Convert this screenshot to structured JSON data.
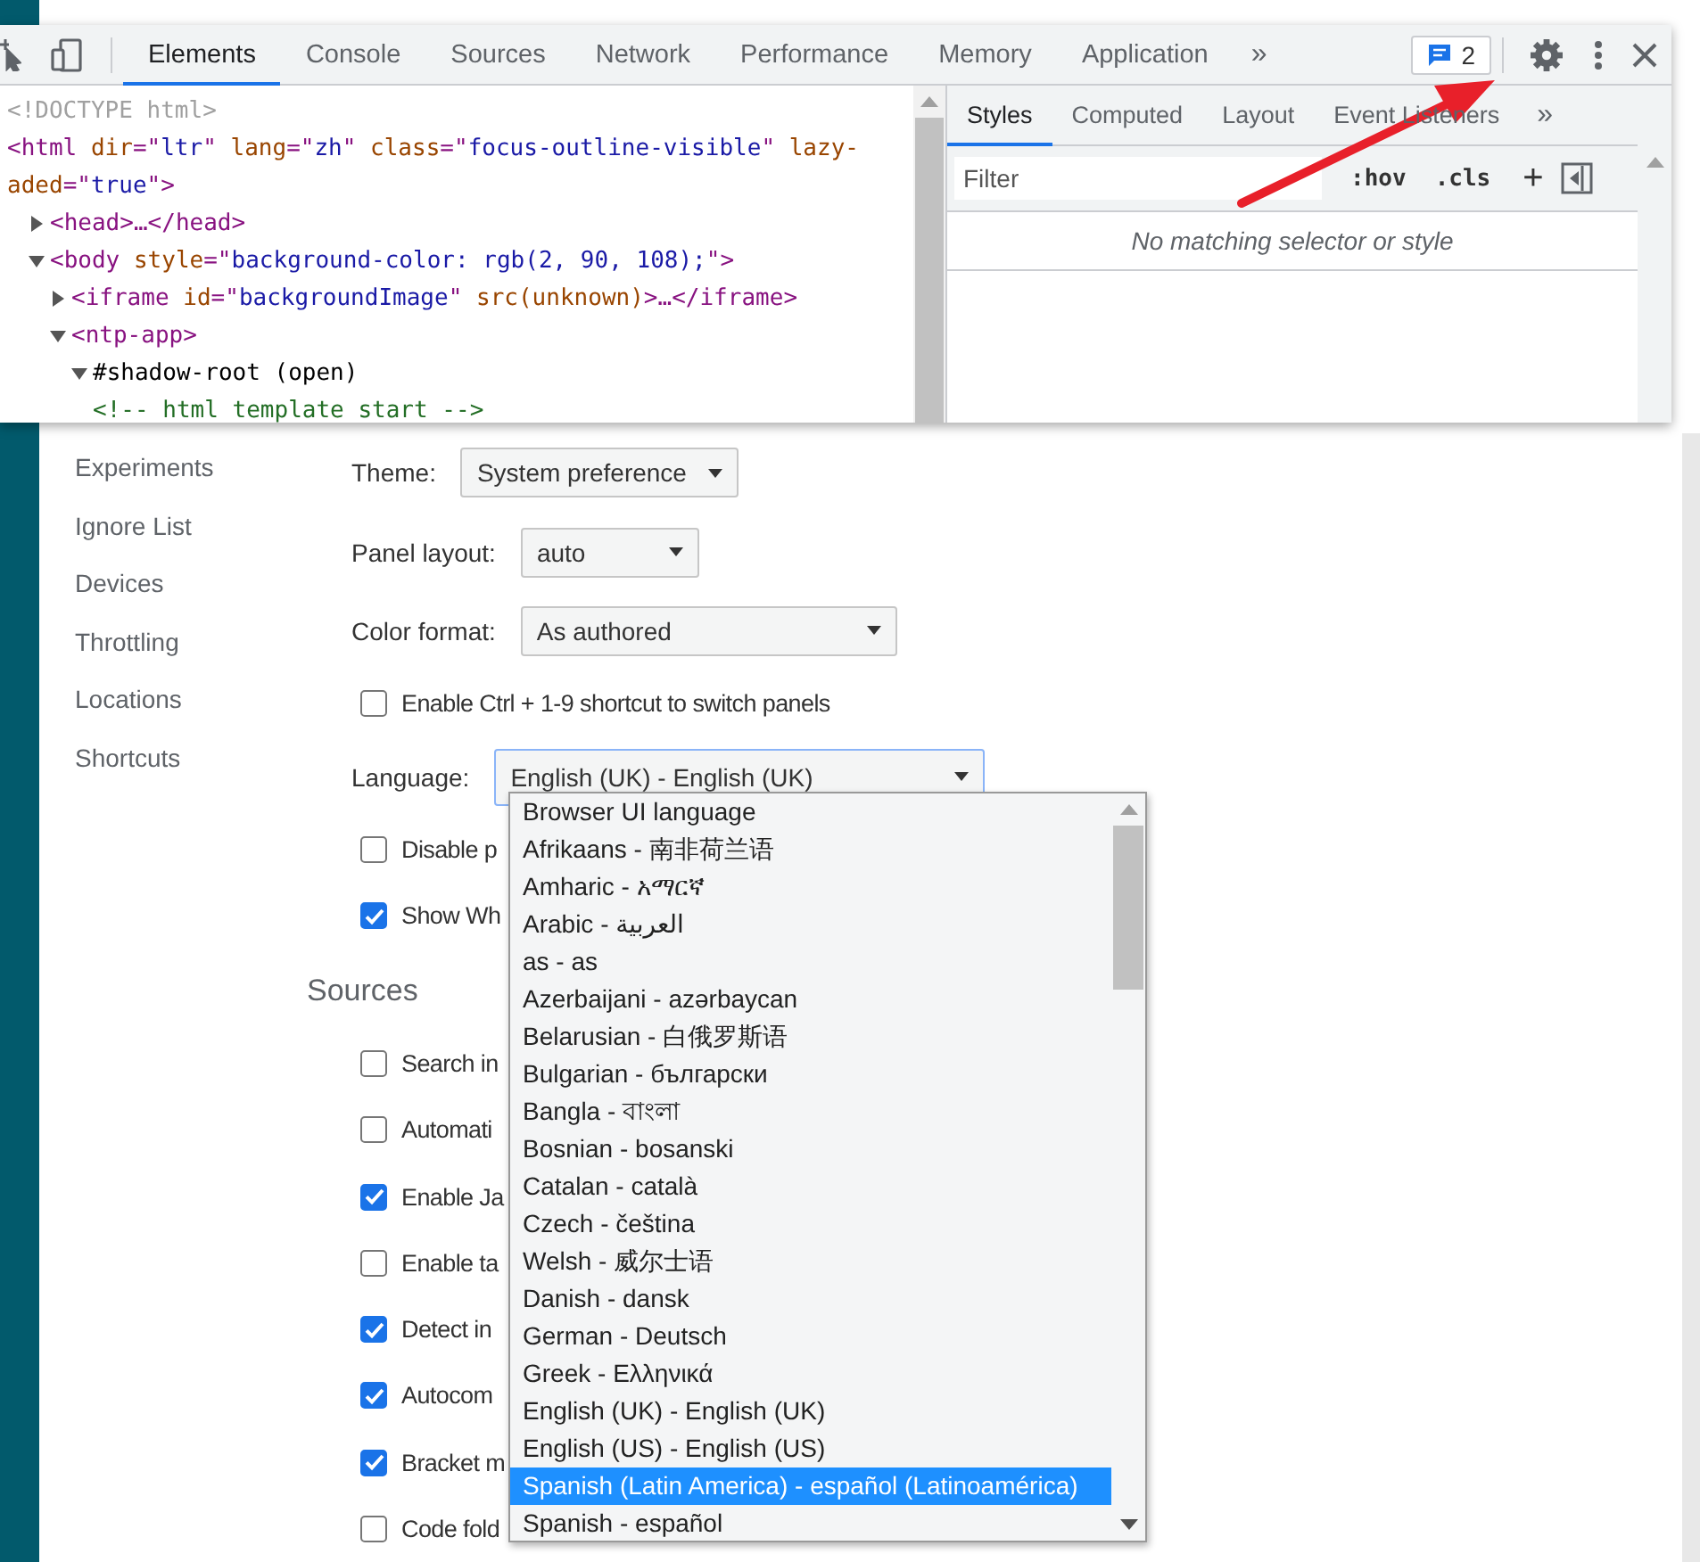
{
  "devtools": {
    "toolbar_tabs": [
      {
        "label": "Elements",
        "selected": true
      },
      {
        "label": "Console",
        "selected": false
      },
      {
        "label": "Sources",
        "selected": false
      },
      {
        "label": "Network",
        "selected": false
      },
      {
        "label": "Performance",
        "selected": false
      },
      {
        "label": "Memory",
        "selected": false
      },
      {
        "label": "Application",
        "selected": false
      }
    ],
    "more_tabs": "»",
    "issues_count": "2",
    "dom_tree": [
      {
        "tokens": [
          {
            "text": "<!DOCTYPE html>",
            "kind": "doctype"
          }
        ]
      },
      {
        "tokens": [
          {
            "text": "<html ",
            "kind": "tag"
          },
          {
            "text": "dir",
            "kind": "attr"
          },
          {
            "text": "=\"",
            "kind": "tag"
          },
          {
            "text": "ltr",
            "kind": "value"
          },
          {
            "text": "\" ",
            "kind": "tag"
          },
          {
            "text": "lang",
            "kind": "attr"
          },
          {
            "text": "=\"",
            "kind": "tag"
          },
          {
            "text": "zh",
            "kind": "value"
          },
          {
            "text": "\" ",
            "kind": "tag"
          },
          {
            "text": "class",
            "kind": "attr"
          },
          {
            "text": "=\"",
            "kind": "tag"
          },
          {
            "text": "focus-outline-visible",
            "kind": "value"
          },
          {
            "text": "\" ",
            "kind": "tag"
          },
          {
            "text": "lazy-",
            "kind": "attr"
          }
        ],
        "wrap": [
          {
            "text": "aded",
            "kind": "attr"
          },
          {
            "text": "=\"",
            "kind": "tag"
          },
          {
            "text": "true",
            "kind": "value"
          },
          {
            "text": "\">",
            "kind": "tag"
          }
        ],
        "children": [
          {
            "expanded": false,
            "tokens": [
              {
                "text": "<head>…</head>",
                "kind": "tag"
              }
            ]
          },
          {
            "expanded": true,
            "tokens": [
              {
                "text": "<body ",
                "kind": "tag"
              },
              {
                "text": "style",
                "kind": "attr"
              },
              {
                "text": "=\"",
                "kind": "tag"
              },
              {
                "text": "background-color: rgb(2, 90, 108);",
                "kind": "value"
              },
              {
                "text": "\">",
                "kind": "tag"
              }
            ],
            "children": [
              {
                "expanded": false,
                "tokens": [
                  {
                    "text": "<iframe ",
                    "kind": "tag"
                  },
                  {
                    "text": "id",
                    "kind": "attr"
                  },
                  {
                    "text": "=\"",
                    "kind": "tag"
                  },
                  {
                    "text": "backgroundImage",
                    "kind": "value"
                  },
                  {
                    "text": "\" ",
                    "kind": "tag"
                  },
                  {
                    "text": "src(unknown)",
                    "kind": "attr"
                  },
                  {
                    "text": ">…</iframe>",
                    "kind": "tag"
                  }
                ]
              },
              {
                "expanded": true,
                "tokens": [
                  {
                    "text": "<ntp-app>",
                    "kind": "tag"
                  }
                ],
                "children": [
                  {
                    "expanded": true,
                    "tokens": [
                      {
                        "text": "#shadow-root (open)",
                        "kind": "text"
                      }
                    ],
                    "children": [
                      {
                        "tokens": [
                          {
                            "text": "<!-- html template start -->",
                            "kind": "comment"
                          }
                        ]
                      }
                    ]
                  }
                ]
              }
            ]
          }
        ]
      }
    ],
    "sidebar_tabs": [
      {
        "label": "Styles",
        "selected": true
      },
      {
        "label": "Computed",
        "selected": false
      },
      {
        "label": "Layout",
        "selected": false
      },
      {
        "label": "Event Listeners",
        "selected": false
      }
    ],
    "sidebar_more": "»",
    "filter": {
      "placeholder": "Filter"
    },
    "hov": ":hov",
    "cls": ".cls",
    "plus": "+",
    "empty_message": "No matching selector or style"
  },
  "settings": {
    "nav": [
      "Experiments",
      "Ignore List",
      "Devices",
      "Throttling",
      "Locations",
      "Shortcuts"
    ],
    "rows": [
      {
        "kind": "select",
        "label": "Theme:",
        "value": "System preference"
      },
      {
        "kind": "select",
        "label": "Panel layout:",
        "value": "auto"
      },
      {
        "kind": "select",
        "label": "Color format:",
        "value": "As authored"
      },
      {
        "kind": "checkbox",
        "label": "Enable Ctrl + 1-9 shortcut to switch panels",
        "checked": false
      },
      {
        "kind": "select",
        "label": "Language:",
        "value": "English (UK) - English (UK)",
        "focused": true
      },
      {
        "kind": "checkbox",
        "label": "Disable p",
        "checked": false
      },
      {
        "kind": "checkbox",
        "label": "Show Wh",
        "checked": true
      },
      {
        "kind": "heading",
        "label": "Sources"
      },
      {
        "kind": "checkbox",
        "label": "Search in",
        "checked": false
      },
      {
        "kind": "checkbox",
        "label": "Automati",
        "checked": false
      },
      {
        "kind": "checkbox",
        "label": "Enable Ja",
        "checked": true
      },
      {
        "kind": "checkbox",
        "label": "Enable ta",
        "checked": false
      },
      {
        "kind": "checkbox",
        "label": "Detect in",
        "checked": true
      },
      {
        "kind": "checkbox",
        "label": "Autocom",
        "checked": true
      },
      {
        "kind": "checkbox",
        "label": "Bracket m",
        "checked": true
      },
      {
        "kind": "checkbox",
        "label": "Code fold",
        "checked": false
      }
    ]
  },
  "language_options": [
    {
      "label": "Browser UI language",
      "selected": false
    },
    {
      "label": "Afrikaans - 南非荷兰语",
      "selected": false
    },
    {
      "label": "Amharic - አማርኛ",
      "selected": false
    },
    {
      "label": "Arabic - العربية",
      "selected": false
    },
    {
      "label": "as - as",
      "selected": false
    },
    {
      "label": "Azerbaijani - azərbaycan",
      "selected": false
    },
    {
      "label": "Belarusian - 白俄罗斯语",
      "selected": false
    },
    {
      "label": "Bulgarian - български",
      "selected": false
    },
    {
      "label": "Bangla - বাংলা",
      "selected": false
    },
    {
      "label": "Bosnian - bosanski",
      "selected": false
    },
    {
      "label": "Catalan - català",
      "selected": false
    },
    {
      "label": "Czech - čeština",
      "selected": false
    },
    {
      "label": "Welsh - 威尔士语",
      "selected": false
    },
    {
      "label": "Danish - dansk",
      "selected": false
    },
    {
      "label": "German - Deutsch",
      "selected": false
    },
    {
      "label": "Greek - Ελληνικά",
      "selected": false
    },
    {
      "label": "English (UK) - English (UK)",
      "selected": false
    },
    {
      "label": "English (US) - English (US)",
      "selected": false
    },
    {
      "label": "Spanish (Latin America) - español (Latinoamérica)",
      "selected": true
    },
    {
      "label": "Spanish - español",
      "selected": false
    }
  ]
}
